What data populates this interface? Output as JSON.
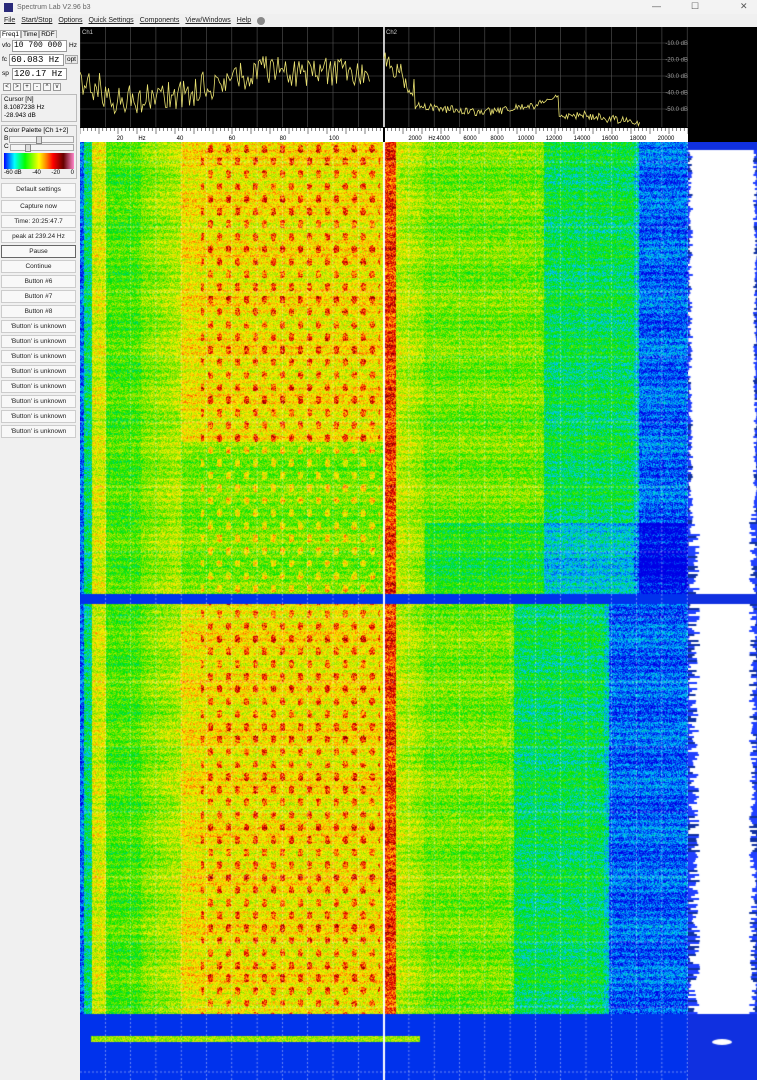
{
  "window": {
    "title": "Spectrum Lab V2.96 b3",
    "controls": [
      "—",
      "☐",
      "✕"
    ]
  },
  "menu": [
    "File",
    "Start/Stop",
    "Options",
    "Quick Settings",
    "Components",
    "View/Windows",
    "Help"
  ],
  "left": {
    "tabs": [
      "Freq1",
      "Time",
      "RDF"
    ],
    "vfo": {
      "label": "vfo",
      "value": "10 700 000",
      "unit": "Hz"
    },
    "fc": {
      "label": "fc",
      "value": "60.083 Hz",
      "opt": "opt"
    },
    "sp": {
      "label": "sp",
      "value": "120.17 Hz"
    },
    "arrows": [
      "<",
      ">",
      "+",
      "-",
      "^",
      "v"
    ],
    "cursor": {
      "title": "Cursor [N]",
      "freq": "8.1087238 Hz",
      "level": "-28.943 dB"
    },
    "palette": {
      "title": "Color Palette [Ch 1+2]",
      "b": "B",
      "c": "C",
      "axis": [
        "-60 dB",
        "-40",
        "-20",
        "0"
      ],
      "b_position": 0.45,
      "c_position": 0.25
    },
    "buttons": [
      "Default settings",
      "Capture now",
      "Time:  20:25:47.7",
      "peak at 239.24 Hz",
      "Pause",
      "Continue",
      "Button #6",
      "Button #7",
      "Button #8",
      "'Button' is unknown",
      "'Button' is unknown",
      "'Button' is unknown",
      "'Button' is unknown",
      "'Button' is unknown",
      "'Button' is unknown",
      "'Button' is unknown",
      "'Button' is unknown"
    ]
  },
  "spectrum": {
    "ch1": {
      "label": "Ch1",
      "ticks": [
        "20",
        "Hz",
        "40",
        "60",
        "80",
        "100"
      ]
    },
    "ch2": {
      "label": "Ch2",
      "ticks": [
        "2000",
        "Hz",
        "4000",
        "6000",
        "8000",
        "10000",
        "12000",
        "14000",
        "16000",
        "18000",
        "20000"
      ]
    },
    "db_labels": [
      "-10.0 dB",
      "-20.0 dB",
      "-30.0 dB",
      "-40.0 dB",
      "-50.0 dB"
    ],
    "trace_color": "#e8e070"
  }
}
